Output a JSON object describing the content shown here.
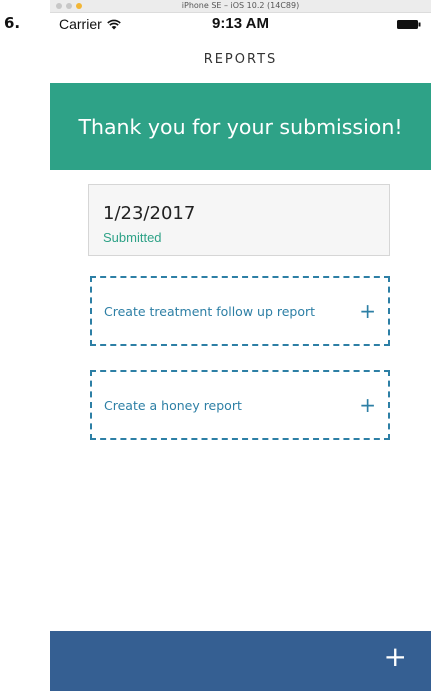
{
  "step": {
    "label": "6."
  },
  "simulator": {
    "title": "iPhone SE – iOS 10.2 (14C89)"
  },
  "status_bar": {
    "carrier": "Carrier",
    "time": "9:13 AM"
  },
  "nav": {
    "title": "REPORTS"
  },
  "banner": {
    "text": "Thank you for your submission!"
  },
  "report": {
    "date": "1/23/2017",
    "status": "Submitted"
  },
  "actions": [
    {
      "label": "Create treatment follow up report",
      "icon": "plus-icon"
    },
    {
      "label": "Create a honey report",
      "icon": "plus-icon"
    }
  ],
  "bottom_bar": {
    "icon": "plus-icon"
  },
  "colors": {
    "banner": "#2ea287",
    "accent": "#2d7fa5",
    "bottom_bar": "#355f92"
  }
}
